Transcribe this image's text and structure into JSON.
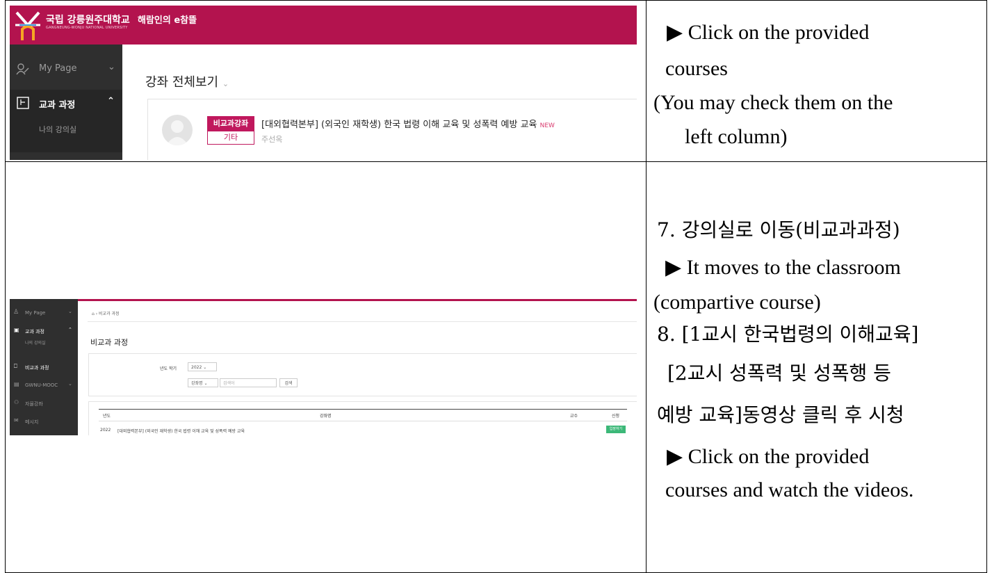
{
  "right_top": {
    "line1": "▶ Click on the provided",
    "line2": "courses",
    "line3": "(You may check them on the",
    "line4": "left column)"
  },
  "right_bottom": {
    "step7": "7. 강의실로 이동(비교과과정)",
    "en1": "▶ It moves to the classroom",
    "en2": "(compartive course)",
    "step8a": "8. [1교시 한국법령의 이해교육]",
    "step8b": "[2교시 성폭력 및 성폭행 등",
    "step8c": "예방 교육]동영상 클릭 후 시청",
    "en3": "▶ Click on the provided",
    "en4": "courses and watch the videos."
  },
  "shot1": {
    "university": "국립 강릉원주대학교",
    "university_sub": "GANGNEUNG-WONJU NATIONAL UNIVERSITY",
    "service": "해람인의 e참뜰",
    "sidebar": [
      {
        "label": "My Page"
      },
      {
        "label": "교과 과정"
      },
      {
        "label": "나의 강의실"
      }
    ],
    "page_title": "강좌 전체보기",
    "badge_top": "비교과강좌",
    "badge_bottom": "기타",
    "course_title": "[대외협력본부] (외국인 재학생) 한국 법령 이해 교육 및 성폭력 예방 교육",
    "new_tag": "NEW",
    "professor": "주선옥"
  },
  "shot2": {
    "sidebar": [
      {
        "label": "My Page"
      },
      {
        "label": "교과 과정"
      },
      {
        "label": "나의 강의실"
      },
      {
        "label": "비교과 과정"
      },
      {
        "label": "GWNU-MOOC"
      },
      {
        "label": "자율강좌"
      },
      {
        "label": "메시지"
      }
    ],
    "breadcrumb": "비교과 과정",
    "page_title": "비교과 과정",
    "filter_label": "년도 학기",
    "year": "2022",
    "search_type": "강좌명",
    "search_placeholder": "검색어",
    "search_button": "검색",
    "columns": [
      "년도",
      "강좌명",
      "교수",
      "신청"
    ],
    "row": {
      "year": "2022",
      "title": "[대외협력본부] (외국인 재학생) 한국 법령 이해 교육 및 성폭력 예방 교육",
      "apply": "입장하기"
    }
  }
}
